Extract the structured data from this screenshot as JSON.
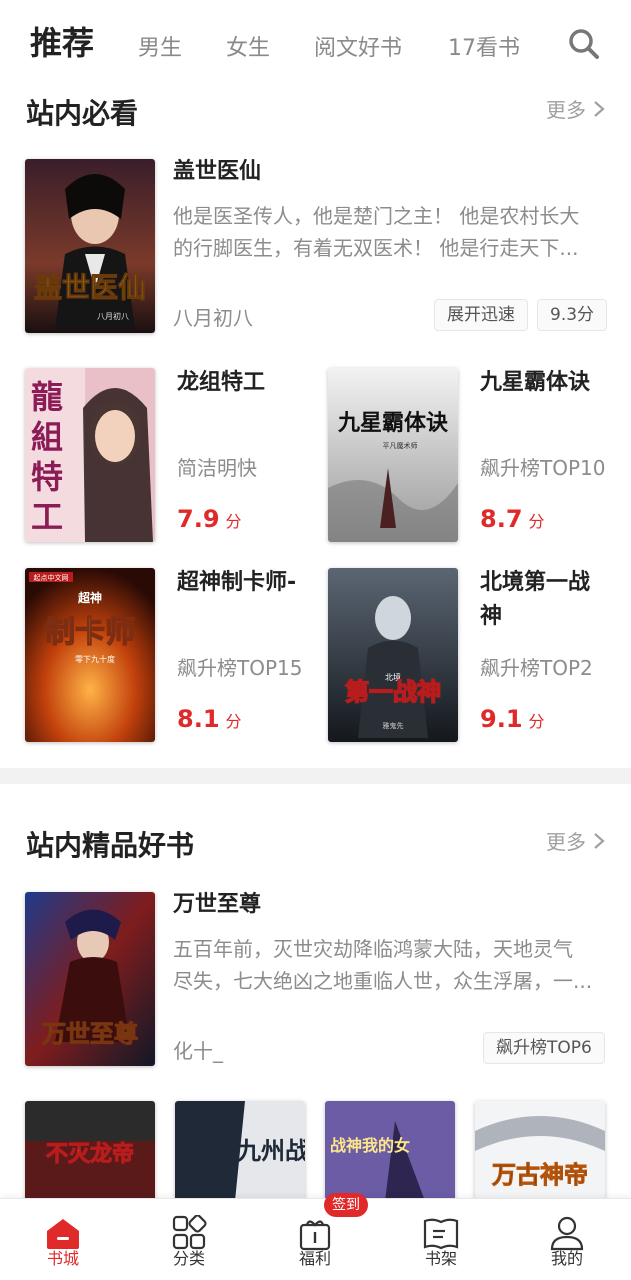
{
  "tabs": {
    "recommend": "推荐",
    "male": "男生",
    "female": "女生",
    "yuewen": "阅文好书",
    "kan17": "17看书"
  },
  "section1": {
    "title": "站内必看",
    "more": "更多",
    "featured": {
      "title": "盖世医仙",
      "desc1": "他是医圣传人，他是楚门之主！ 他是农村长大",
      "desc2": "的行脚医生，有着无双医术！ 他是行走天下...",
      "author": "八月初八",
      "tag1": "展开迅速",
      "tag2": "9.3分",
      "cover_text": "盖世医仙",
      "cover_author": "八月初八"
    },
    "grid": [
      {
        "title": "龙组特工",
        "meta": "简洁明快",
        "score": "7.9",
        "unit": "分",
        "cover_text": "龍組特工"
      },
      {
        "title": "九星霸体诀",
        "meta": "飙升榜TOP10",
        "score": "8.7",
        "unit": "分",
        "cover_text": "九星霸体诀",
        "cover_author": "平凡魔术师"
      },
      {
        "title": "超神制卡师-",
        "meta": "飙升榜TOP15",
        "score": "8.1",
        "unit": "分",
        "cover_text": "制卡师",
        "cover_top": "超神",
        "cover_author": "零下九十度",
        "cover_brand": "起点中文网"
      },
      {
        "title": "北境第一战神",
        "meta": "飙升榜TOP2",
        "score": "9.1",
        "unit": "分",
        "cover_text": "第一战神",
        "cover_top": "北境",
        "cover_author": "雅鬼先"
      }
    ]
  },
  "section2": {
    "title": "站内精品好书",
    "more": "更多",
    "featured": {
      "title": "万世至尊",
      "desc1": "五百年前，灭世灾劫降临鸿蒙大陆，天地灵气",
      "desc2": "尽失，七大绝凶之地重临人世，众生浮屠，一...",
      "author": "化十_",
      "tag1": "飙升榜TOP6",
      "cover_text": "万世至尊"
    },
    "row": [
      {
        "cover_text": "不灭龙帝"
      },
      {
        "cover_text": "九州战"
      },
      {
        "cover_text": "战神我的女"
      },
      {
        "cover_text": "万古神帝"
      }
    ]
  },
  "bottom_nav": {
    "bookcity": "书城",
    "category": "分类",
    "welfare": "福利",
    "welfare_badge": "签到",
    "shelf": "书架",
    "mine": "我的"
  },
  "colors": {
    "accent": "#e02a2a",
    "muted": "#8c8c8c"
  }
}
